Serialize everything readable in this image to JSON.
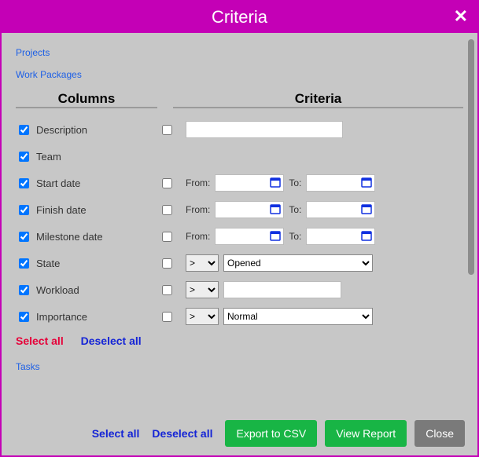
{
  "title": "Criteria",
  "sections": {
    "projects": "Projects",
    "workPackages": "Work Packages",
    "tasks": "Tasks"
  },
  "headers": {
    "columns": "Columns",
    "criteria": "Criteria"
  },
  "rows": {
    "description": {
      "label": "Description",
      "col": true,
      "crit": false,
      "value": ""
    },
    "team": {
      "label": "Team",
      "col": true
    },
    "startDate": {
      "label": "Start date",
      "col": true,
      "crit": false,
      "fromLabel": "From:",
      "toLabel": "To:",
      "from": "",
      "to": ""
    },
    "finishDate": {
      "label": "Finish date",
      "col": true,
      "crit": false,
      "fromLabel": "From:",
      "toLabel": "To:",
      "from": "",
      "to": ""
    },
    "milestoneDate": {
      "label": "Milestone date",
      "col": true,
      "crit": false,
      "fromLabel": "From:",
      "toLabel": "To:",
      "from": "",
      "to": ""
    },
    "state": {
      "label": "State",
      "col": true,
      "crit": false,
      "op": ">",
      "value": "Opened"
    },
    "workload": {
      "label": "Workload",
      "col": true,
      "crit": false,
      "op": ">",
      "value": ""
    },
    "importance": {
      "label": "Importance",
      "col": true,
      "crit": false,
      "op": ">",
      "value": "Normal"
    }
  },
  "groupActions": {
    "selectAll": "Select all",
    "deselectAll": "Deselect all"
  },
  "footer": {
    "selectAll": "Select all",
    "deselectAll": "Deselect all",
    "export": "Export to CSV",
    "view": "View Report",
    "close": "Close"
  }
}
